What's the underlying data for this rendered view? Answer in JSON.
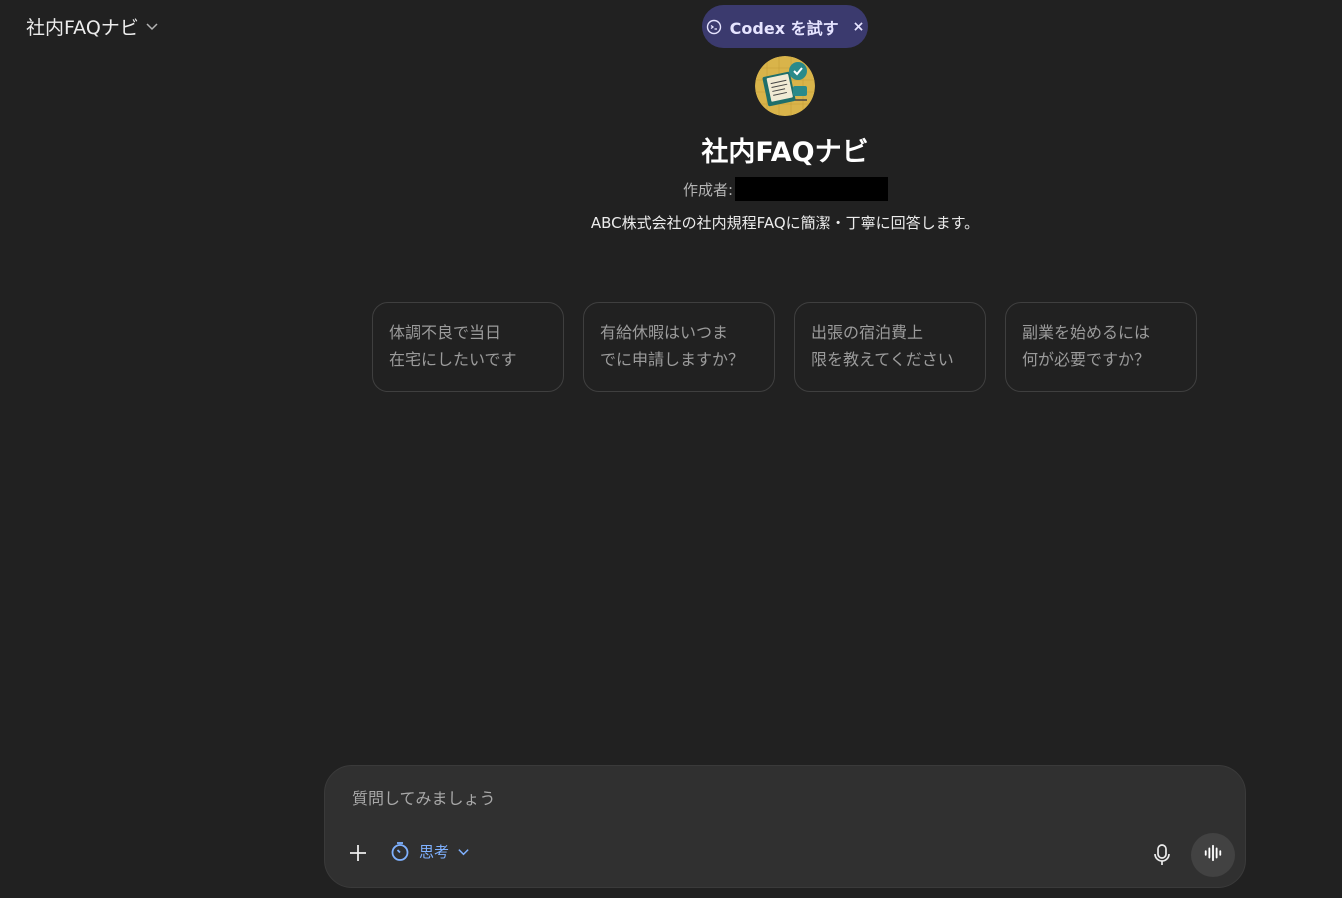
{
  "header": {
    "model_name": "社内FAQナビ",
    "promo_label": "Codex を試す",
    "promo_close": "×",
    "icons": {
      "model_dropdown": "chevron-down-icon",
      "promo": "codex-icon"
    }
  },
  "gpt": {
    "title": "社内FAQナビ",
    "author_label": "作成者:",
    "description": "ABC株式会社の社内規程FAQに簡潔・丁寧に回答します。"
  },
  "suggestions": [
    {
      "line1": "体調不良で当日",
      "line2": "在宅にしたいです"
    },
    {
      "line1": "有給休暇はいつま",
      "line2": "でに申請しますか？"
    },
    {
      "line1": "出張の宿泊費上",
      "line2": "限を教えてください"
    },
    {
      "line1": "副業を始めるには",
      "line2": "何が必要ですか？"
    }
  ],
  "composer": {
    "placeholder": "質問してみましょう",
    "mode_label": "思考",
    "icons": {
      "attach": "plus-icon",
      "mode": "timer-icon",
      "mode_dropdown": "chevron-down-icon",
      "mic": "microphone-icon",
      "voice": "voice-waveform-icon"
    }
  },
  "colors": {
    "background": "#212121",
    "composer": "#303030",
    "promo_pill": "#3b3a6e",
    "accent_blue": "#7fb1ff"
  }
}
